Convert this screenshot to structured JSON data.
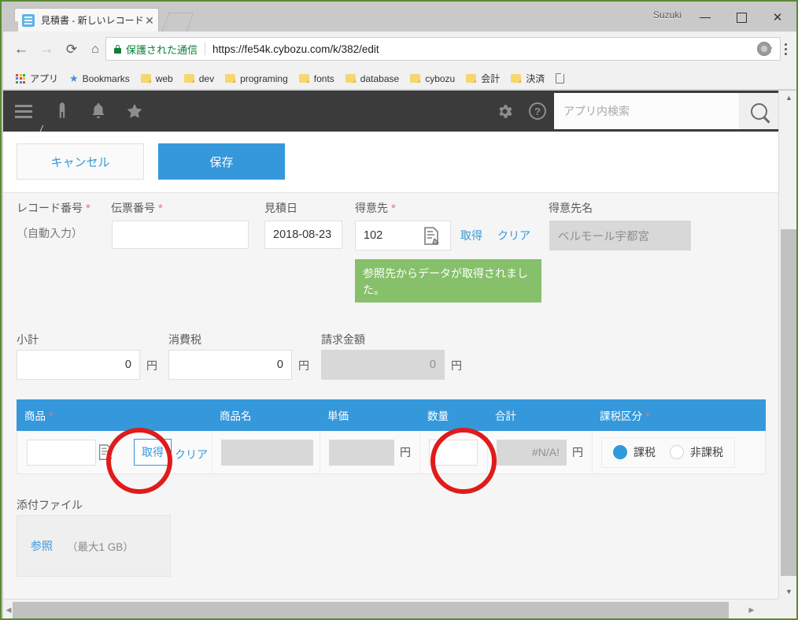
{
  "browser": {
    "window_user": "Suzuki",
    "minimize_label": "—",
    "maximize_label": "□",
    "close_label": "✕",
    "tab": {
      "title": "見積書 - 新しいレコード",
      "close_label": "✕",
      "favicon_name": "kintone-favicon"
    },
    "nav": {
      "back": "←",
      "forward": "→",
      "reload": "⟳",
      "home": "⌂"
    },
    "omnibox": {
      "secure_label": "保護された通信",
      "url": "https://fe54k.cybozu.com/k/382/edit",
      "star": "☆"
    },
    "bookmarks": [
      {
        "label": "アプリ",
        "icon": "apps-grid-icon"
      },
      {
        "label": "Bookmarks",
        "icon": "star-icon"
      },
      {
        "label": "web",
        "icon": "folder-icon"
      },
      {
        "label": "dev",
        "icon": "folder-icon"
      },
      {
        "label": "programing",
        "icon": "folder-icon"
      },
      {
        "label": "fonts",
        "icon": "folder-icon"
      },
      {
        "label": "database",
        "icon": "folder-icon"
      },
      {
        "label": "cybozu",
        "icon": "folder-icon"
      },
      {
        "label": "会計",
        "icon": "folder-icon"
      },
      {
        "label": "決済",
        "icon": "folder-icon"
      },
      {
        "label": "",
        "icon": "page-icon"
      }
    ]
  },
  "app_header": {
    "menu_icon": "hamburger-icon",
    "home_icon": "home-icon",
    "bell_icon": "bell-icon",
    "star_icon": "star-icon",
    "gear_icon": "gear-icon",
    "help_icon": "help-icon",
    "search_placeholder": "アプリ内検索",
    "search_value": "",
    "search_button_icon": "search-icon"
  },
  "actions": {
    "cancel_label": "キャンセル",
    "save_label": "保存"
  },
  "form": {
    "record_number": {
      "label": "レコード番号",
      "required": "*",
      "value_text": "（自動入力）"
    },
    "slip_number": {
      "label": "伝票番号",
      "required": "*",
      "value": ""
    },
    "quote_date": {
      "label": "見積日",
      "value": "2018-08-23"
    },
    "customer": {
      "label": "得意先",
      "required": "*",
      "value": "102",
      "lookup_icon": "lookup-icon",
      "get_label": "取得",
      "clear_label": "クリア",
      "message": "参照先からデータが取得されました。"
    },
    "customer_name": {
      "label": "得意先名",
      "value": "ベルモール宇都宮"
    },
    "subtotal": {
      "label": "小計",
      "value": "0",
      "unit": "円"
    },
    "tax": {
      "label": "消費税",
      "value": "0",
      "unit": "円"
    },
    "billing_amount": {
      "label": "請求金額",
      "value": "0",
      "unit": "円"
    },
    "attachment": {
      "label": "添付ファイル",
      "browse_label": "参照",
      "limit_label": "（最大1 GB）"
    }
  },
  "subtable": {
    "columns": [
      {
        "label": "商品",
        "required": "*"
      },
      {
        "label": "商品名",
        "required": ""
      },
      {
        "label": "単価",
        "required": ""
      },
      {
        "label": "数量",
        "required": ""
      },
      {
        "label": "合計",
        "required": ""
      },
      {
        "label": "課税区分",
        "required": "*"
      }
    ],
    "row": {
      "product_code": "",
      "get_label": "取得",
      "clear_label": "クリア",
      "product_name": "",
      "unit_price": "",
      "unit_price_unit": "円",
      "quantity": "",
      "total": "#N/A!",
      "total_unit": "円",
      "tax_options": [
        {
          "label": "課税",
          "selected": true
        },
        {
          "label": "非課税",
          "selected": false
        }
      ]
    }
  },
  "scrollbars": {
    "v_up": "▲",
    "v_down": "▼",
    "h_left": "◀",
    "h_right": "▶"
  },
  "colors": {
    "accent_blue": "#3498db",
    "header_dark": "#3b3b3b",
    "success_green": "#86c06a",
    "annotation_red": "#e01b1b",
    "window_border_green": "#5a8a32"
  }
}
